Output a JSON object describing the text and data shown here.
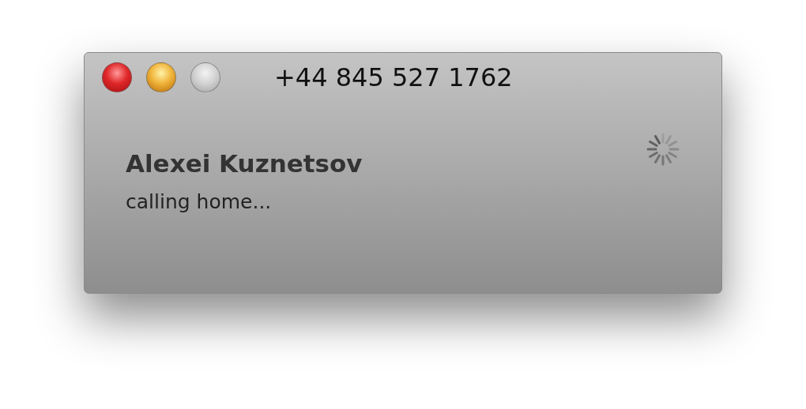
{
  "window": {
    "title": "+44 845 527 1762",
    "buttons": [
      {
        "kind": "close",
        "disabled": false
      },
      {
        "kind": "minimize",
        "disabled": false
      },
      {
        "kind": "zoom",
        "disabled": true
      }
    ]
  },
  "call": {
    "name": "Alexei Kuznetsov",
    "status": "calling home...",
    "busy": true
  }
}
